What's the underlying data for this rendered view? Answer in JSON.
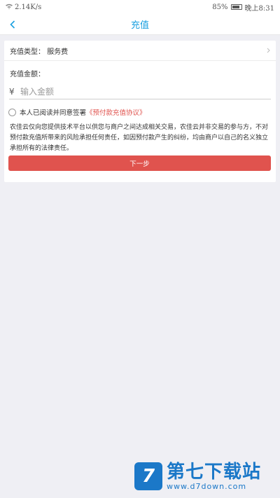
{
  "status_bar": {
    "network_speed": "2.14K/s",
    "battery": "85%",
    "time": "晚上8:31"
  },
  "nav": {
    "title": "充值",
    "back_icon": "chevron-left-icon"
  },
  "form": {
    "type_label": "充值类型：",
    "type_value": "服务费",
    "amount_label": "充值金额：",
    "currency_symbol": "¥",
    "amount_value": "",
    "amount_placeholder": "输入金额",
    "agree_prefix": "本人已阅读并同意签署",
    "agreement_link": "《预付款充值协议》",
    "disclaimer": "农佳云仅向您提供技术平台以供您与商户之间达成相关交易，农佳云并非交易的参与方，不对预付款充值所带来的风险承担任何责任，如因预付款产生的纠纷，均由商户以自己的名义独立承担所有的法律责任。",
    "next_button": "下一步"
  },
  "watermark": {
    "logo_letter": "7",
    "name": "第七下载站",
    "url": "www.d7down.com"
  },
  "colors": {
    "accent": "#1aa0e0",
    "button": "#e0534e",
    "link": "#e0534e",
    "background": "#efeff4"
  }
}
